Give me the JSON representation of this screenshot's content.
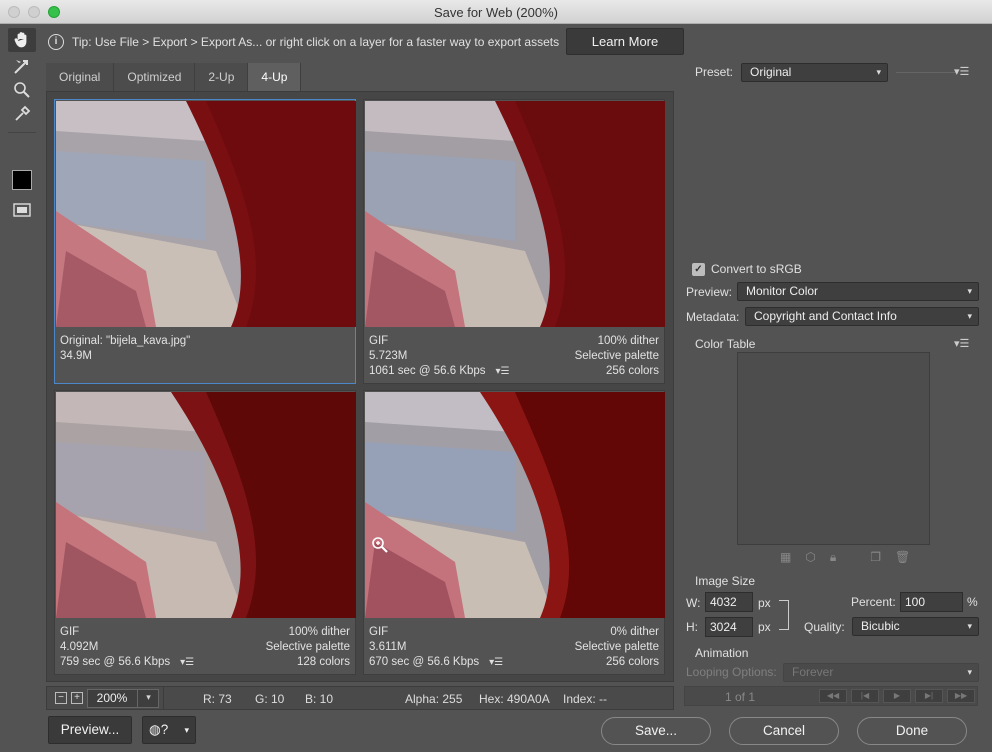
{
  "window": {
    "title": "Save for Web (200%)"
  },
  "tip": {
    "text": "Tip: Use File > Export > Export As...  or right click on a layer for a faster way to export assets",
    "learn_more": "Learn More"
  },
  "tabs": [
    {
      "label": "Original"
    },
    {
      "label": "Optimized"
    },
    {
      "label": "2-Up"
    },
    {
      "label": "4-Up"
    }
  ],
  "panes": [
    {
      "line1_left": "Original: \"bijela_kava.jpg\"",
      "line1_right": "",
      "line2_left": "34.9M",
      "line2_right": "",
      "line3_left": "",
      "line3_right": ""
    },
    {
      "line1_left": "GIF",
      "line1_right": "100% dither",
      "line2_left": "5.723M",
      "line2_right": "Selective palette",
      "line3_left": "1061 sec @ 56.6 Kbps",
      "line3_right": "256 colors"
    },
    {
      "line1_left": "GIF",
      "line1_right": "100% dither",
      "line2_left": "4.092M",
      "line2_right": "Selective palette",
      "line3_left": "759 sec @ 56.6 Kbps",
      "line3_right": "128 colors"
    },
    {
      "line1_left": "GIF",
      "line1_right": "0% dither",
      "line2_left": "3.611M",
      "line2_right": "Selective palette",
      "line3_left": "670 sec @ 56.6 Kbps",
      "line3_right": "256 colors"
    }
  ],
  "status": {
    "zoom": "200%",
    "r": "R: 73",
    "g": "G: 10",
    "b": "B: 10",
    "alpha": "Alpha: 255",
    "hex": "Hex: 490A0A",
    "index": "Index: --"
  },
  "buttons": {
    "preview": "Preview...",
    "save": "Save...",
    "cancel": "Cancel",
    "done": "Done"
  },
  "settings": {
    "preset_label": "Preset:",
    "preset_value": "Original",
    "convert_srgb": "Convert to sRGB",
    "preview_label": "Preview:",
    "preview_value": "Monitor Color",
    "metadata_label": "Metadata:",
    "metadata_value": "Copyright and Contact Info",
    "color_table": "Color Table",
    "image_size": "Image Size",
    "w_label": "W:",
    "w_value": "4032",
    "h_label": "H:",
    "h_value": "3024",
    "px": "px",
    "percent_label": "Percent:",
    "percent_value": "100",
    "percent_unit": "%",
    "quality_label": "Quality:",
    "quality_value": "Bicubic",
    "animation": "Animation",
    "looping_label": "Looping Options:",
    "looping_value": "Forever",
    "frame_count": "1 of 1"
  },
  "colors": {
    "accent": "#4b87c9",
    "image_red": "#6e0d0d"
  }
}
